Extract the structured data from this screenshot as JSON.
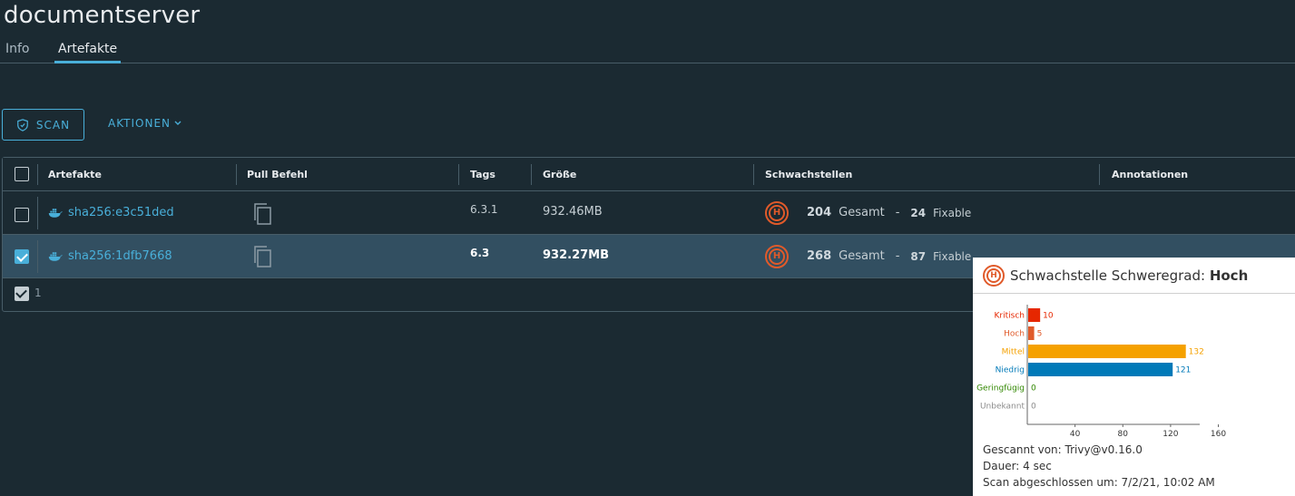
{
  "title": "documentserver",
  "tabs": {
    "info": "Info",
    "artefakte": "Artefakte"
  },
  "toolbar": {
    "scan": "SCAN",
    "aktionen": "AKTIONEN"
  },
  "columns": [
    "Artefakte",
    "Pull Befehl",
    "Tags",
    "Größe",
    "Schwachstellen",
    "Annotationen"
  ],
  "rows": [
    {
      "digest": "sha256:e3c51ded",
      "tag": "6.3.1",
      "size": "932.46MB",
      "severity_letter": "H",
      "total": "204",
      "total_label": "Gesamt",
      "fixable": "24",
      "fixable_label": "Fixable",
      "checked": false
    },
    {
      "digest": "sha256:1dfb7668",
      "tag": "6.3",
      "size": "932.27MB",
      "severity_letter": "H",
      "total": "268",
      "total_label": "Gesamt",
      "fixable": "87",
      "fixable_label": "Fixable",
      "checked": true
    }
  ],
  "footer": {
    "count": "1"
  },
  "popover": {
    "badge": "H",
    "title_prefix": "Schwachstelle Schweregrad:",
    "title_value": "Hoch",
    "scanned_by": "Gescannt von: Trivy@v0.16.0",
    "duration": "Dauer: 4 sec",
    "completed": "Scan abgeschlossen um: 7/2/21, 10:02 AM"
  },
  "colors": {
    "accent": "#49afd9",
    "critical": "#e62700",
    "high": "#e05a2a",
    "medium": "#f5a100",
    "low": "#0079b8",
    "negligible": "#318700",
    "unknown": "#8c8c8c"
  },
  "chart_data": {
    "type": "bar",
    "orientation": "horizontal",
    "categories": [
      "Kritisch",
      "Hoch",
      "Mittel",
      "Niedrig",
      "Geringfügig",
      "Unbekannt"
    ],
    "values": [
      10,
      5,
      132,
      121,
      0,
      0
    ],
    "colors": [
      "#e62700",
      "#e05a2a",
      "#f5a100",
      "#0079b8",
      "#318700",
      "#8c8c8c"
    ],
    "xticks": [
      40,
      80,
      120,
      160
    ],
    "xlim": [
      0,
      190
    ]
  }
}
